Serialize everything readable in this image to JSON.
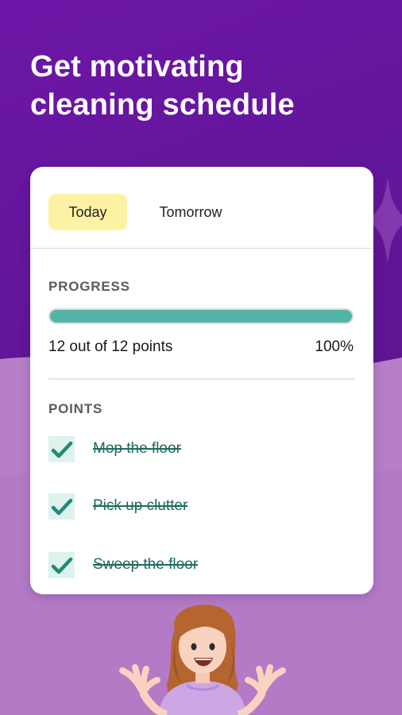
{
  "colors": {
    "background": "#6a1a9e",
    "wave": "#b67fc7",
    "today_tab": "#fdf1a3",
    "progress_fill": "#52b5a5",
    "checkbox_bg": "#def2ee",
    "check": "#1f8a78",
    "done_text": "#1f6b5d"
  },
  "headline": {
    "line1": "Get motivating",
    "line2": "cleaning schedule"
  },
  "tabs": [
    {
      "label": "Today",
      "selected": true
    },
    {
      "label": "Tomorrow",
      "selected": false
    }
  ],
  "progress": {
    "section_label": "PROGRESS",
    "summary": "12 out of 12 points",
    "percent_label": "100%",
    "fraction": 1.0
  },
  "points": {
    "section_label": "POINTS",
    "items": [
      {
        "label": "Mop the floor",
        "done": true,
        "icon": "check-icon"
      },
      {
        "label": "Pick up clutter",
        "done": true,
        "icon": "check-icon"
      },
      {
        "label": "Sweep the floor",
        "done": true,
        "icon": "check-icon"
      }
    ]
  },
  "illustration": "woman-excited-illustration"
}
